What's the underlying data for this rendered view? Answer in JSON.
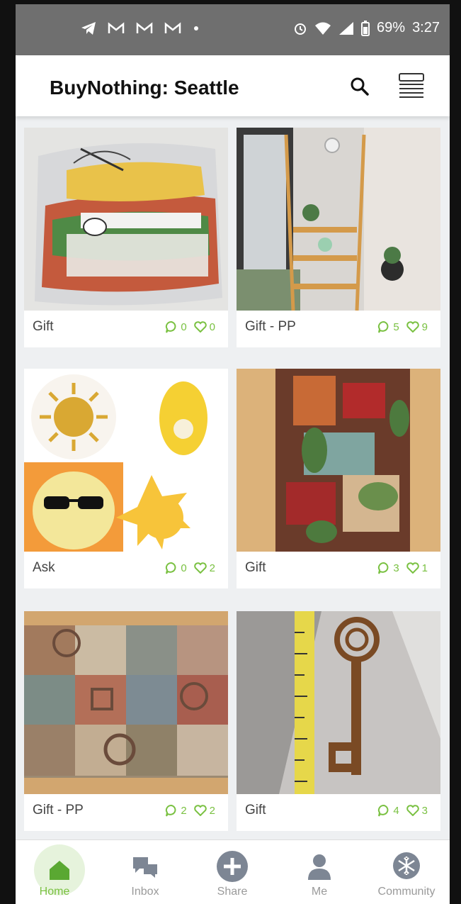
{
  "status_bar": {
    "icons": [
      "telegram-icon",
      "gmail-icon",
      "gmail-icon",
      "gmail-icon",
      "dot-icon"
    ],
    "right_icons": [
      "alarm-icon",
      "wifi-icon",
      "signal-icon",
      "battery-icon"
    ],
    "battery": "69%",
    "time": "3:27"
  },
  "app_bar": {
    "title": "BuyNothing: Seattle"
  },
  "posts": [
    {
      "label": "Gift",
      "comments": "0",
      "likes": "0"
    },
    {
      "label": "Gift - PP",
      "comments": "5",
      "likes": "9"
    },
    {
      "label": "Ask",
      "comments": "0",
      "likes": "2"
    },
    {
      "label": "Gift",
      "comments": "3",
      "likes": "1"
    },
    {
      "label": "Gift - PP",
      "comments": "2",
      "likes": "2"
    },
    {
      "label": "Gift",
      "comments": "4",
      "likes": "3"
    }
  ],
  "bottom_nav": {
    "items": [
      {
        "label": "Home",
        "icon": "home-icon"
      },
      {
        "label": "Inbox",
        "icon": "chat-icon"
      },
      {
        "label": "Share",
        "icon": "plus-circle-icon"
      },
      {
        "label": "Me",
        "icon": "person-icon"
      },
      {
        "label": "Community",
        "icon": "snowflake-icon"
      }
    ]
  },
  "colors": {
    "accent": "#7ac142",
    "statusbar": "#6f6f6f",
    "nav_inactive": "#9a9a9a"
  }
}
